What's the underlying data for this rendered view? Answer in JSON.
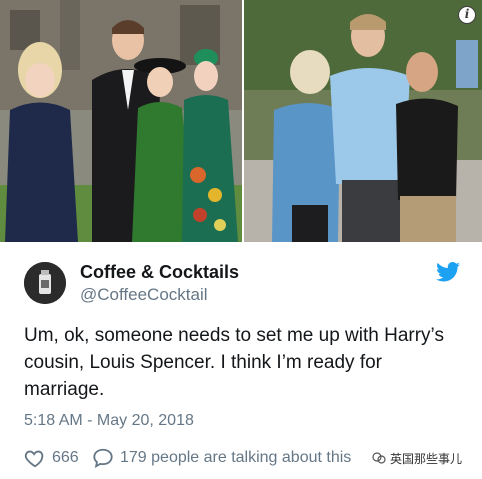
{
  "tweet": {
    "display_name": "Coffee & Cocktails",
    "handle": "@CoffeeCocktail",
    "text": "Um, ok, someone needs to set me up with Harry’s cousin, Louis Spencer. I think I’m ready for marriage.",
    "timestamp": "5:18 AM - May 20, 2018",
    "like_count": "666",
    "talking_text": "179 people are talking about this"
  },
  "icons": {
    "info": "info-icon",
    "like": "heart-icon",
    "reply": "speech-bubble-icon",
    "brand": "twitter-bird-icon"
  },
  "watermark": {
    "text": "英国那些事儿"
  },
  "colors": {
    "brand_blue": "#1da1f2",
    "secondary_text": "#657786",
    "primary_text": "#14171a"
  }
}
